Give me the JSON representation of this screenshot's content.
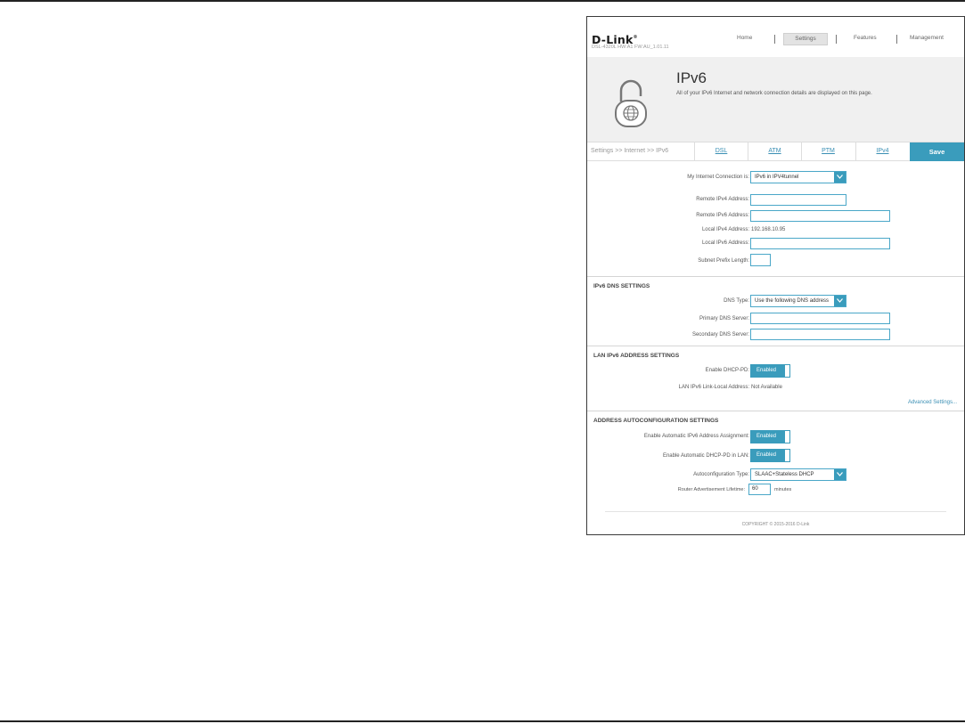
{
  "header": {
    "brand": "D-Link",
    "model": "DSL-4320L   HW:A1   FW:AU_1.01.11",
    "nav": [
      "Home",
      "Settings",
      "Features",
      "Management"
    ]
  },
  "banner": {
    "title": "IPv6",
    "description": "All of your IPv6 Internet and network connection details are displayed on this page.",
    "icon": "lock-globe-icon"
  },
  "tabs": {
    "breadcrumb": "Settings >> Internet >> IPv6",
    "items": [
      "DSL",
      "ATM",
      "PTM",
      "IPv4"
    ],
    "save_label": "Save"
  },
  "connection": {
    "type_label": "My Internet Connection is:",
    "type_value": "IPv6 in IPV4tunnel",
    "remote_ipv4_label": "Remote IPv4 Address:",
    "remote_ipv4_value": "",
    "remote_ipv6_label": "Remote IPv6 Address:",
    "remote_ipv6_value": "",
    "local_ipv4_label": "Local IPv4 Address:",
    "local_ipv4_value": "192.168.10.95",
    "local_ipv6_label": "Local IPv6 Address:",
    "local_ipv6_value": "",
    "prefix_label": "Subnet Prefix Length:",
    "prefix_value": ""
  },
  "dns": {
    "title": "IPv6 DNS SETTINGS",
    "type_label": "DNS Type:",
    "type_value": "Use the following DNS address",
    "primary_label": "Primary DNS Server:",
    "primary_value": "",
    "secondary_label": "Secondary DNS Server:",
    "secondary_value": ""
  },
  "lan": {
    "title": "LAN IPv6 ADDRESS SETTINGS",
    "dhcp_pd_label": "Enable DHCP-PD:",
    "dhcp_pd_value": "Enabled",
    "link_local_label": "LAN IPv6 Link-Local Address:",
    "link_local_value": "Not Available",
    "advanced_link": "Advanced Settings..."
  },
  "autoconfig": {
    "title": "ADDRESS AUTOCONFIGURATION SETTINGS",
    "auto_assign_label": "Enable Automatic IPv6 Address Assignment:",
    "auto_assign_value": "Enabled",
    "auto_pd_label": "Enable Automatic DHCP-PD in LAN:",
    "auto_pd_value": "Enabled",
    "type_label": "Autoconfiguration Type:",
    "type_value": "SLAAC+Stateless DHCP",
    "lifetime_label": "Router Advertisement Lifetime:",
    "lifetime_value": "60",
    "lifetime_unit": "minutes"
  },
  "footer": {
    "copyright": "COPYRIGHT © 2015-2016 D-Link"
  },
  "colors": {
    "accent": "#3a9cbc",
    "link": "#3a8fb4",
    "banner_bg": "#f0f0f0"
  }
}
